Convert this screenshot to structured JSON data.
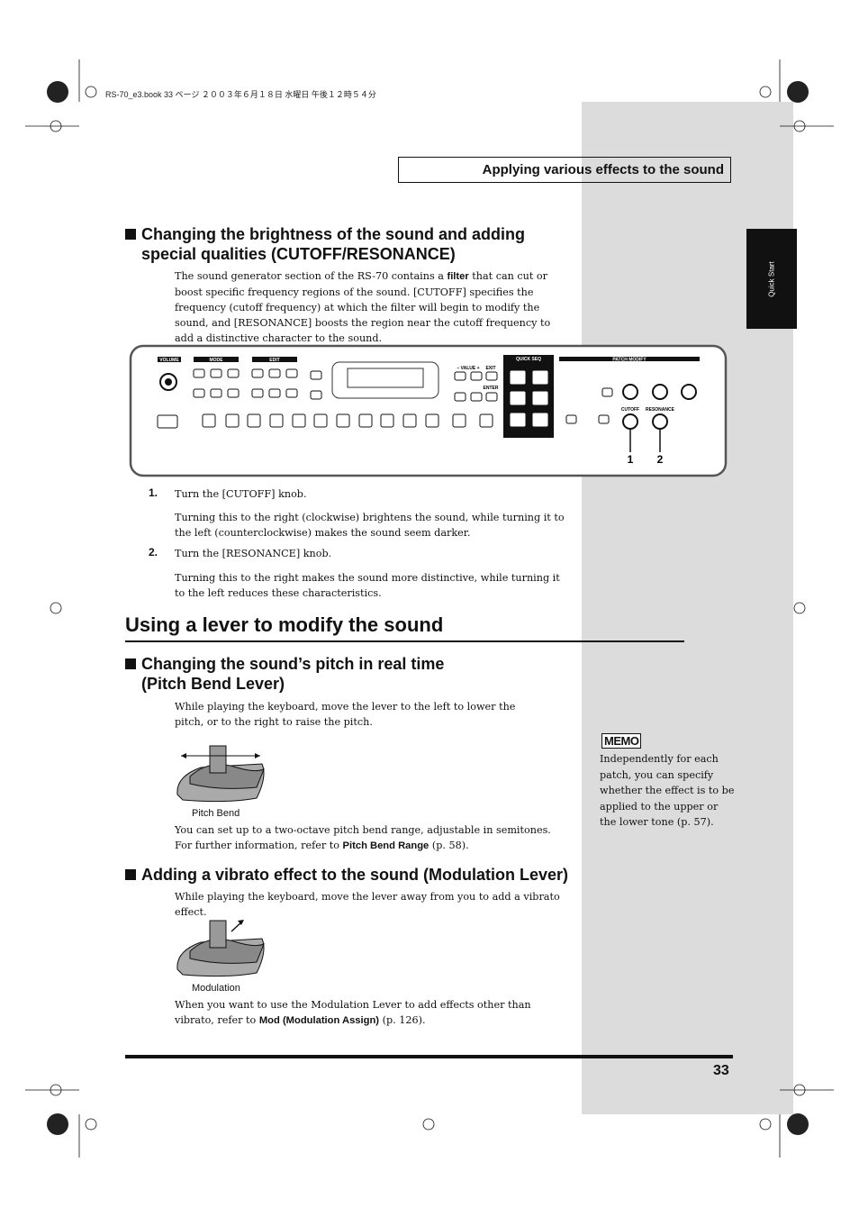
{
  "book_info": "RS-70_e3.book  33 ページ  ２００３年６月１８日  水曜日  午後１２時５４分",
  "header": {
    "title": "Applying various effects to the sound"
  },
  "side_tab": "Quick Start",
  "section1": {
    "heading_line1": "Changing the brightness of the sound and adding",
    "heading_line2": "special qualities (CUTOFF/RESONANCE)",
    "intro_pre": "The sound generator section of the RS-70 contains a ",
    "intro_bold": "filter",
    "intro_post": " that can cut or boost specific frequency regions of the sound. [CUTOFF] specifies the frequency (cutoff frequency) at which the filter will begin to modify the sound, and [RESONANCE] boosts the region near the cutoff frequency to add a distinctive character to the sound.",
    "panel": {
      "labels": {
        "volume": "VOLUME",
        "mode": "MODE",
        "edit": "EDIT",
        "value": "– VALUE +",
        "exit": "EXIT",
        "enter": "ENTER",
        "quick_seq": "QUICK SEQ",
        "patch_modify": "PATCH MODIFY",
        "cutoff": "CUTOFF",
        "resonance": "RESONANCE"
      },
      "callouts": [
        "1",
        "2"
      ]
    },
    "steps": [
      {
        "num": "1.",
        "title": "Turn the [CUTOFF] knob.",
        "detail": "Turning this to the right (clockwise) brightens the sound, while turning it to the left (counterclockwise) makes the sound seem darker."
      },
      {
        "num": "2.",
        "title": "Turn the [RESONANCE] knob.",
        "detail": "Turning this to the right makes the sound more distinctive, while turning it to the left reduces these characteristics."
      }
    ]
  },
  "main_heading": "Using a lever to modify the sound",
  "section2": {
    "heading_line1": "Changing the sound’s pitch in real time",
    "heading_line2": "(Pitch Bend Lever)",
    "text": "While playing the keyboard, move the lever to the left to lower the pitch, or to the right to raise the pitch.",
    "caption": "Pitch Bend",
    "after1": "You can set up to a two-octave pitch bend range, adjustable in semitones.",
    "after2_pre": "For further information, refer to ",
    "after2_bold": "Pitch Bend Range",
    "after2_post": " (p. 58)."
  },
  "section3": {
    "heading": "Adding a vibrato effect to the sound (Modulation Lever)",
    "text": "While playing the keyboard, move the lever away from you to add a vibrato effect.",
    "caption": "Modulation",
    "after_pre": "When you want to use the Modulation Lever to add effects other than vibrato, refer to ",
    "after_bold": "Mod (Modulation Assign)",
    "after_post": " (p. 126)."
  },
  "memo": {
    "title": "MEMO",
    "text": "Independently for each patch, you can specify whether the effect is to be applied to the upper or the lower tone (p. 57)."
  },
  "page_number": "33"
}
